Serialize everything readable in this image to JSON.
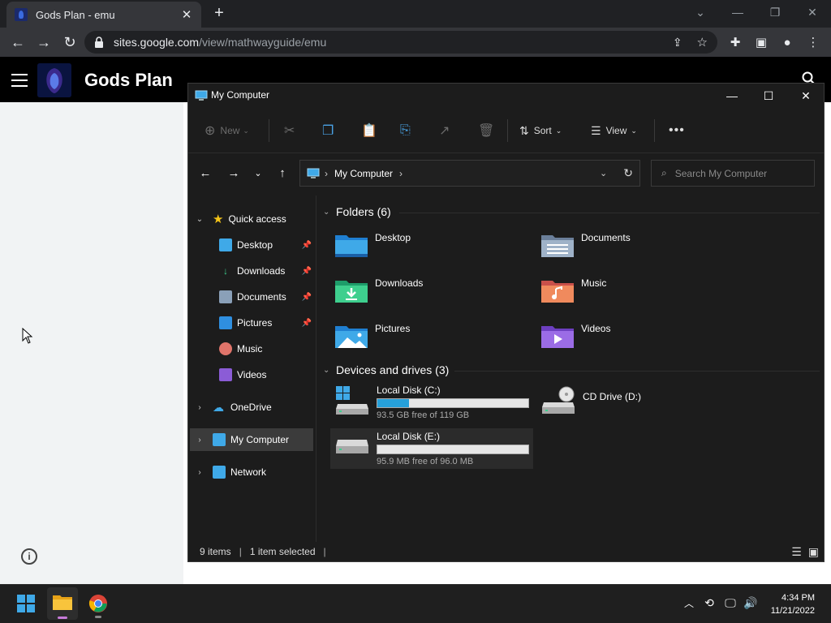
{
  "browser": {
    "tab_title": "Gods Plan - emu",
    "url_domain": "sites.google.com",
    "url_path": "/view/mathwayguide/emu"
  },
  "site": {
    "title": "Gods Plan"
  },
  "explorer": {
    "title": "My Computer",
    "commands": {
      "new": "New",
      "sort": "Sort",
      "view": "View"
    },
    "address": "My Computer",
    "search_placeholder": "Search My Computer",
    "nav": {
      "quick_access": "Quick access",
      "desktop": "Desktop",
      "downloads": "Downloads",
      "documents": "Documents",
      "pictures": "Pictures",
      "music": "Music",
      "videos": "Videos",
      "onedrive": "OneDrive",
      "my_computer": "My Computer",
      "network": "Network"
    },
    "folders_header": "Folders (6)",
    "folders": [
      "Desktop",
      "Documents",
      "Downloads",
      "Music",
      "Pictures",
      "Videos"
    ],
    "drives_header": "Devices and drives (3)",
    "drives": [
      {
        "name": "Local Disk (C:)",
        "free": "93.5 GB free of 119 GB",
        "used_fraction": 0.21
      },
      {
        "name": "CD Drive (D:)"
      },
      {
        "name": "Local Disk (E:)",
        "free": "95.9 MB free of 96.0 MB",
        "used_fraction": 0.0
      }
    ],
    "status": {
      "items": "9 items",
      "selected": "1 item selected"
    }
  },
  "taskbar": {
    "time": "4:34 PM",
    "date": "11/21/2022"
  },
  "colors": {
    "accent": "#26a0da",
    "explorer_bg": "#1c1c1c"
  }
}
